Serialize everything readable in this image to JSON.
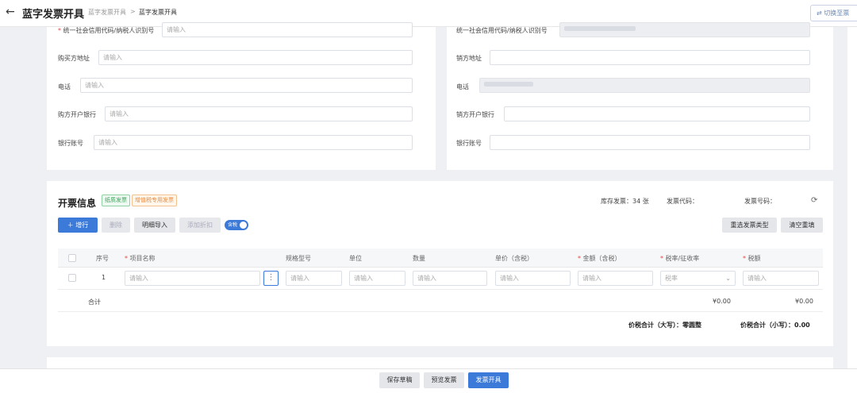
{
  "header": {
    "back_icon": "arrow-left-icon",
    "title": "蓝字发票开具",
    "breadcrumb": [
      "蓝字发票开具",
      "蓝字发票开具"
    ],
    "breadcrumb_sep": ">",
    "switch_button": "切换至票"
  },
  "buyer": {
    "tax_id_label": "统一社会信用代码/纳税人识别号",
    "tax_id_placeholder": "请输入",
    "address_label": "购买方地址",
    "address_placeholder": "请输入",
    "phone_label": "电话",
    "phone_placeholder": "请输入",
    "bank_label": "购方开户银行",
    "bank_placeholder": "请输入",
    "account_label": "银行账号",
    "account_placeholder": "请输入"
  },
  "seller": {
    "tax_id_label": "统一社会信用代码/纳税人识别号",
    "address_label": "销方地址",
    "phone_label": "电话",
    "bank_label": "销方开户银行",
    "account_label": "银行账号"
  },
  "invoice": {
    "title": "开票信息",
    "tag_paper": "纸质发票",
    "tag_special": "增值税专用发票",
    "stock": "库存发票：34 张",
    "code_label": "发票代码：",
    "number_label": "发票号码：",
    "refresh_icon": "refresh-icon"
  },
  "toolbar": {
    "add_row": "＋ 增行",
    "delete": "删除",
    "import_detail": "明细导入",
    "add_discount": "添加折扣",
    "tax_included_toggle": "含税",
    "reselect_type": "重选发票类型",
    "clear_refill": "清空重填"
  },
  "table": {
    "headers": [
      "序号",
      "项目名称",
      "规格型号",
      "单位",
      "数量",
      "单价（含税）",
      "金额（含税）",
      "税率/征收率",
      "税额"
    ],
    "row": {
      "index": "1",
      "placeholder": "请输入",
      "tax_rate_placeholder": "税率"
    },
    "total_label": "合计",
    "total_amount": "¥0.00",
    "total_tax": "¥0.00",
    "grand_total_upper": "价税合计（大写）：零圆整",
    "grand_total_lower": "价税合计（小写）：0.00"
  },
  "footer": {
    "save_draft": "保存草稿",
    "preview": "预览发票",
    "issue": "发票开具"
  },
  "colors": {
    "primary": "#3b7ad9",
    "required": "#e54545"
  }
}
